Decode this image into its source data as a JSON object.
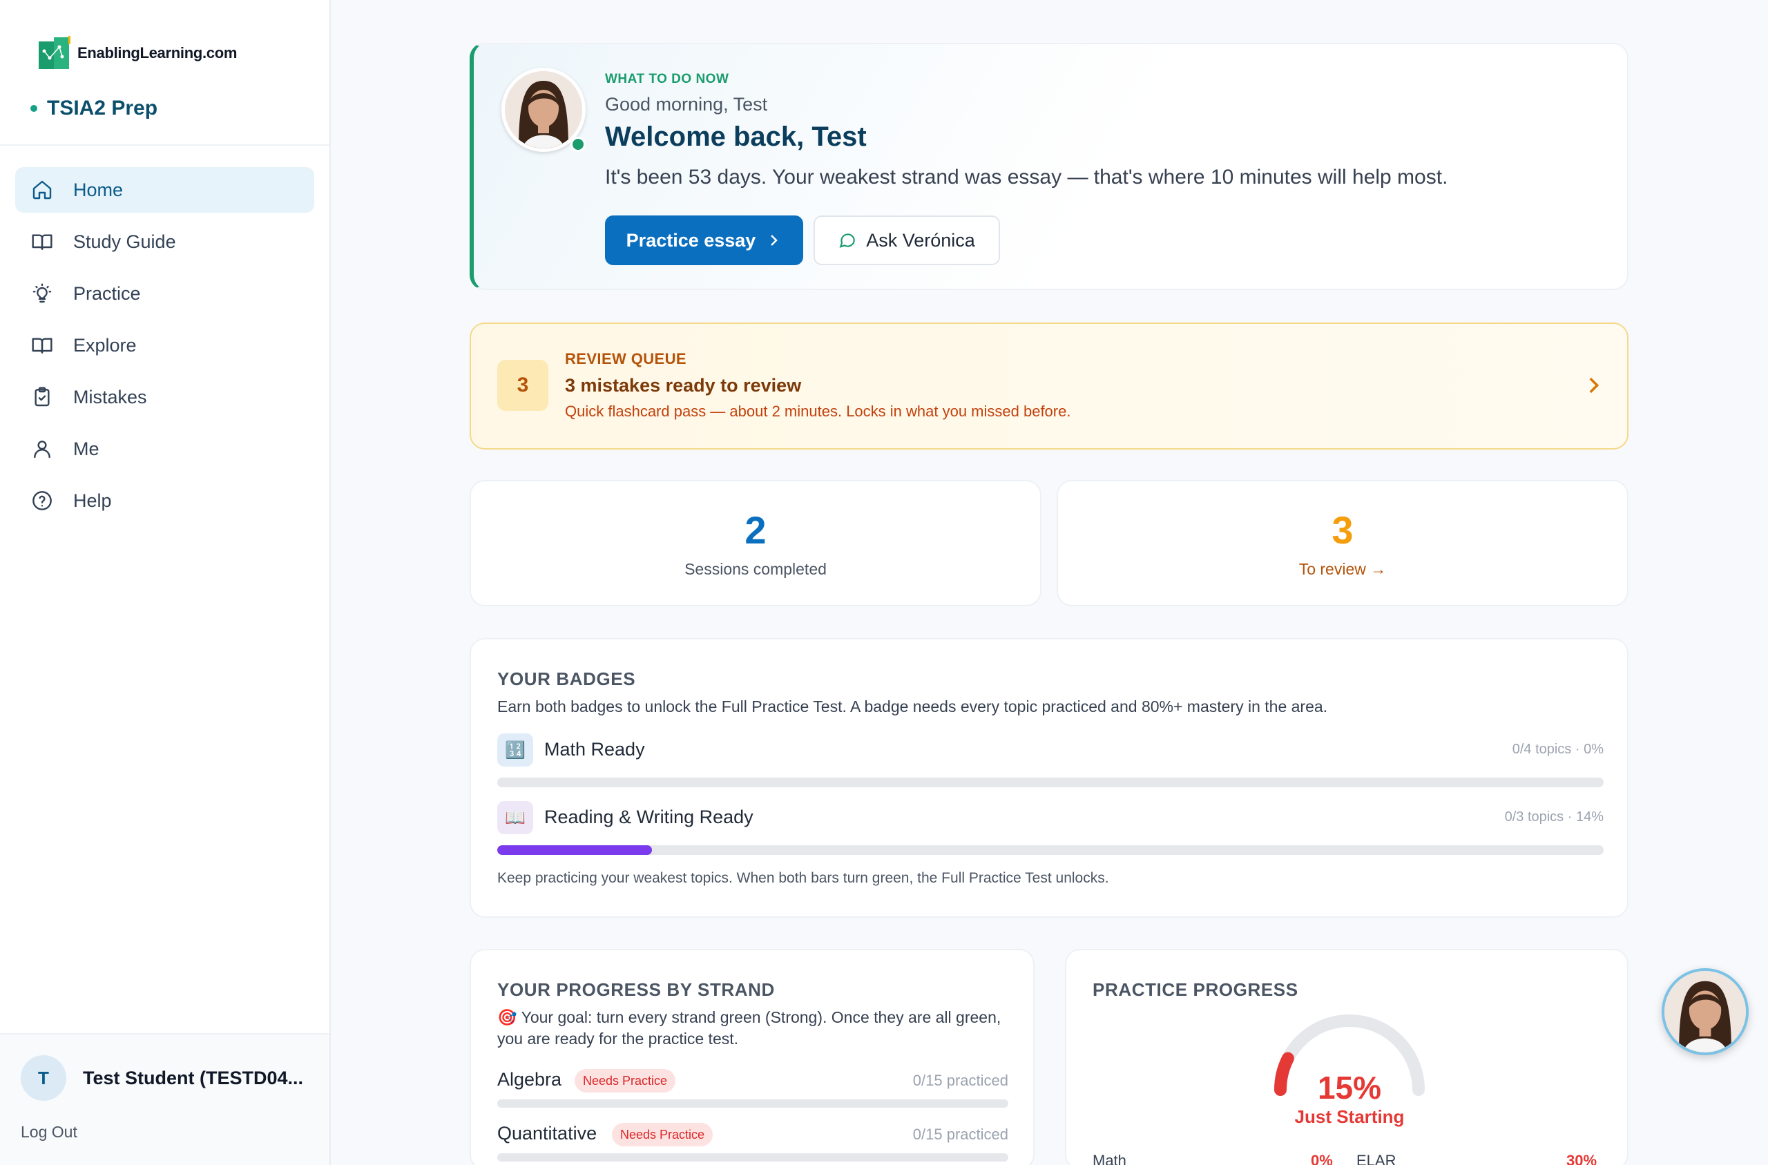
{
  "brand": {
    "logo_text": "EnablingLearning.com",
    "product": "TSIA2 Prep"
  },
  "nav": [
    {
      "label": "Home",
      "icon": "home-icon",
      "active": true
    },
    {
      "label": "Study Guide",
      "icon": "book-open-icon"
    },
    {
      "label": "Practice",
      "icon": "lightbulb-icon"
    },
    {
      "label": "Explore",
      "icon": "book-open-icon"
    },
    {
      "label": "Mistakes",
      "icon": "clipboard-check-icon"
    },
    {
      "label": "Me",
      "icon": "user-icon"
    },
    {
      "label": "Help",
      "icon": "help-circle-icon"
    }
  ],
  "user": {
    "initial": "T",
    "name": "Test Student (TESTD04...",
    "logout": "Log Out"
  },
  "welcome": {
    "eyebrow": "WHAT TO DO NOW",
    "greeting": "Good morning, Test",
    "title": "Welcome back, Test",
    "message": "It's been 53 days. Your weakest strand was essay — that's where 10 minutes will help most.",
    "primary_btn": "Practice essay",
    "secondary_btn": "Ask Verónica"
  },
  "review": {
    "count": "3",
    "eyebrow": "REVIEW QUEUE",
    "title": "3 mistakes ready to review",
    "subtitle": "Quick flashcard pass — about 2 minutes. Locks in what you missed before."
  },
  "stats": [
    {
      "value": "2",
      "label": "Sessions completed",
      "color": "#0b6fc0",
      "label_color": "#4b5563"
    },
    {
      "value": "3",
      "label": "To review →",
      "color": "#f59e0b",
      "label_color": "#b45309"
    }
  ],
  "badges": {
    "title": "YOUR BADGES",
    "subtitle": "Earn both badges to unlock the Full Practice Test. A badge needs every topic practiced and 80%+ mastery in the area.",
    "items": [
      {
        "name": "Math Ready",
        "meta": "0/4 topics · 0%",
        "progress": 0.0,
        "icon": "🔢",
        "icon_bg": "#e0ecf8",
        "fill": "#7c3aed"
      },
      {
        "name": "Reading & Writing Ready",
        "meta": "0/3 topics · 14%",
        "progress": 0.14,
        "icon": "📖",
        "icon_bg": "#ede7f8",
        "fill": "#7c3aed"
      }
    ],
    "note": "Keep practicing your weakest topics. When both bars turn green, the Full Practice Test unlocks."
  },
  "strand": {
    "title": "YOUR PROGRESS BY STRAND",
    "goal": "🎯 Your goal: turn every strand green (Strong). Once they are all green, you are ready for the practice test.",
    "items": [
      {
        "name": "Algebra",
        "status": "Needs Practice",
        "meta": "0/15 practiced"
      },
      {
        "name": "Quantitative",
        "status": "Needs Practice",
        "meta": "0/15 practiced"
      }
    ]
  },
  "practice": {
    "title": "PRACTICE PROGRESS",
    "percent": "15%",
    "percent_value": 0.15,
    "label": "Just Starting",
    "gauge_color": "#e53935",
    "breakdown": [
      {
        "name": "Math",
        "value": "0%"
      },
      {
        "name": "ELAR",
        "value": "30%"
      }
    ]
  }
}
